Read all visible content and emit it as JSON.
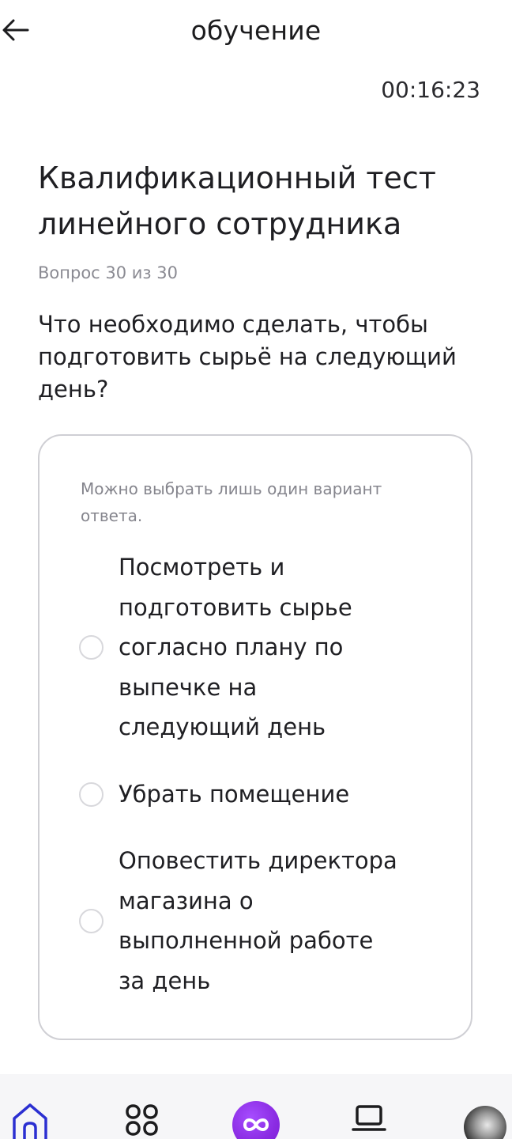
{
  "header": {
    "title": "обучение"
  },
  "timer": "00:16:23",
  "test": {
    "title": "Квалификационный тест линейного сотрудника",
    "question_count": "Вопрос 30 из 30",
    "question": "Что необходимо сделать, чтобы подготовить сырьё на следующий день?"
  },
  "answers": {
    "hint": "Можно выбрать лишь один вариант ответа.",
    "options": [
      {
        "label": "Посмотреть и подготовить сырье согласно плану по выпечке на следующий день",
        "selected": false
      },
      {
        "label": "Убрать помещение",
        "selected": false
      },
      {
        "label": "Оповестить директора магазина о выполненной работе за день",
        "selected": false
      }
    ]
  },
  "bottom_nav": {
    "items": [
      "home-icon",
      "apps-grid-icon",
      "infinity-logo-icon",
      "laptop-icon",
      "profile-avatar"
    ],
    "accent": "#8a2be2",
    "icon_color": "#2b2fd1"
  },
  "colors": {
    "text": "#1f1f23",
    "muted": "#8a8a92",
    "card_border": "#cfcfd4",
    "nav_background": "#f6f6f8"
  }
}
